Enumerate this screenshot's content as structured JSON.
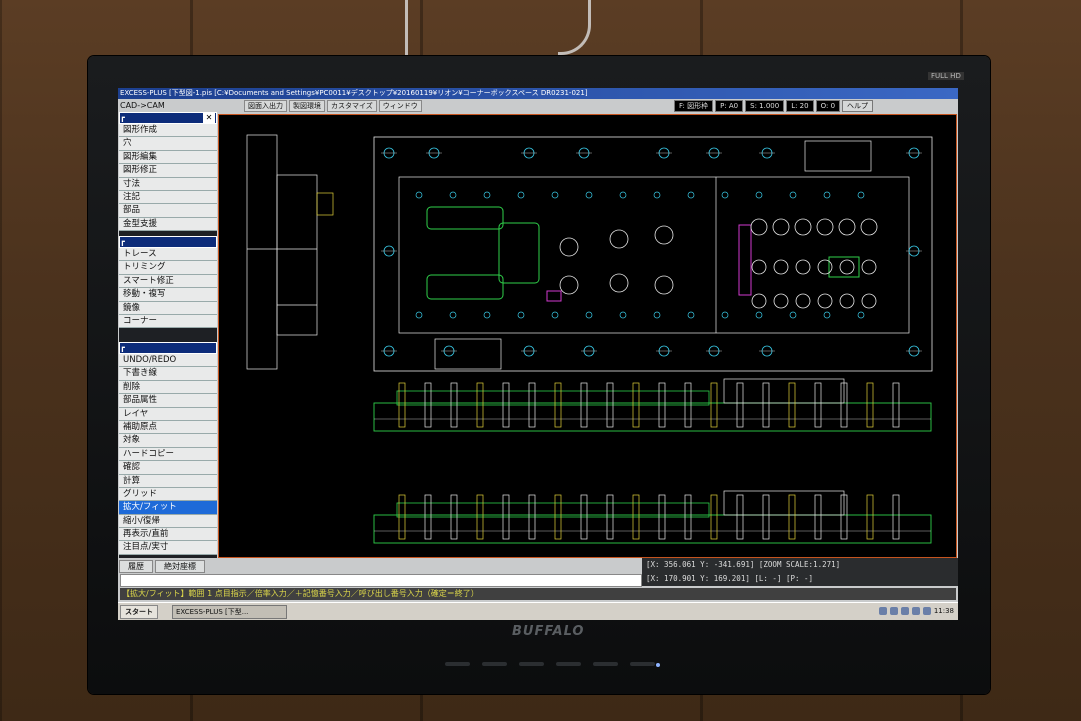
{
  "window_title": "EXCESS-PLUS [下型図-1.pis [C:¥Documents and Settings¥PC0011¥デスクトップ¥20160119¥リオン¥コーナーボックスペース    DR0231-021]",
  "menu_left": "CAD->CAM",
  "tabs": [
    "図面入出力",
    "製図環境",
    "カスタマイズ",
    "ウィンドウ"
  ],
  "status_top": [
    "F: 図形枠",
    "P: A0",
    "S: 1.000",
    "L: 20",
    "O: 0",
    "ヘルプ"
  ],
  "side_group1": [
    "図形作成",
    "穴",
    "図形編集",
    "図形修正",
    "寸法",
    "注記",
    "部品",
    "金型支援"
  ],
  "side_group2": [
    "トレース",
    "トリミング",
    "スマート修正",
    "移動・複写",
    "鏡像",
    "コーナー"
  ],
  "side_group3": [
    "UNDO/REDO",
    "下書き線",
    "削除",
    "部品属性",
    "レイヤ",
    "補助原点",
    "対象",
    "ハードコピー",
    "確認",
    "計算",
    "グリッド",
    "拡大/フィット",
    "縮小/復帰",
    "再表示/直前",
    "注目点/実寸"
  ],
  "active_item": "拡大/フィット",
  "bottom_tabs": [
    "履歴",
    "絶対座標"
  ],
  "coords": {
    "line1": "[X:    356.061 Y:   -341.691] [ZOOM SCALE:1.271]",
    "line2": "[X:    170.901 Y:    169.201] [L:   -] [P:   -]"
  },
  "prompt": "【拡大/フィット】範囲 1 点目指示／倍率入力／＋記憶番号入力／呼び出し番号入力（確定＝終了）",
  "taskbar": {
    "start": "スタート",
    "task": "EXCESS-PLUS [下型...",
    "clock": "11:38"
  },
  "monitor_brand": "BUFFALO",
  "monitor_badge": "FULL HD",
  "colors": {
    "cad_bg": "#000000",
    "titlebar": "#1c3f8f",
    "active": "#1e6ad8",
    "prompt_text": "#dcd74a"
  }
}
